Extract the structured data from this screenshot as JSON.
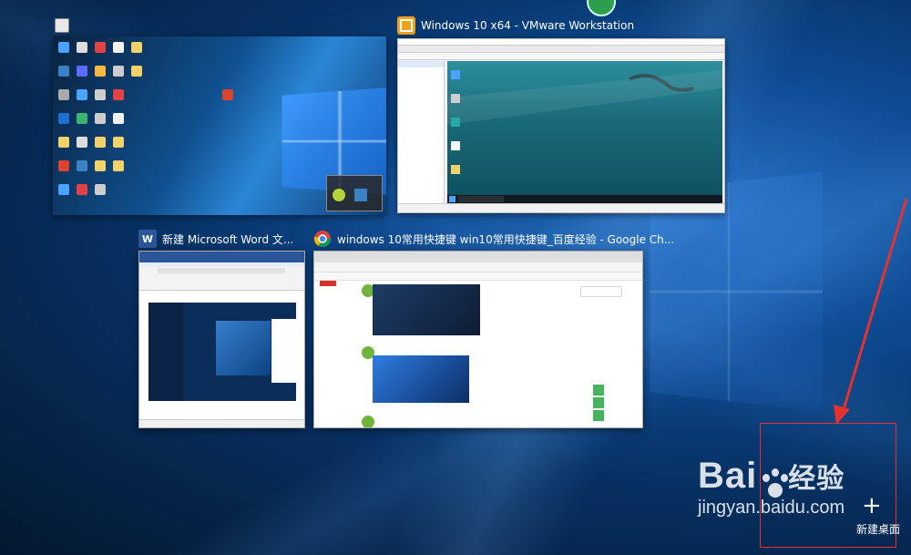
{
  "windows": [
    {
      "id": "desktop",
      "title": "",
      "icon": "desktop-icon"
    },
    {
      "id": "vmware",
      "title": "Windows 10 x64 - VMware Workstation",
      "icon": "vmware-icon"
    },
    {
      "id": "word",
      "title": "新建 Microsoft Word 文...",
      "icon": "word-icon",
      "icon_letter": "W"
    },
    {
      "id": "chrome",
      "title": "windows 10常用快捷键 win10常用快捷键_百度经验 - Google Ch...",
      "icon": "chrome-icon"
    }
  ],
  "new_desktop": {
    "plus": "+",
    "label": "新建桌面"
  },
  "watermark": {
    "brand": "Bai",
    "brand2": "经验",
    "url": "jingyan.baidu.com"
  },
  "colors": {
    "annotation_red": "#e6322e",
    "accent_blue": "#0e4b93"
  }
}
